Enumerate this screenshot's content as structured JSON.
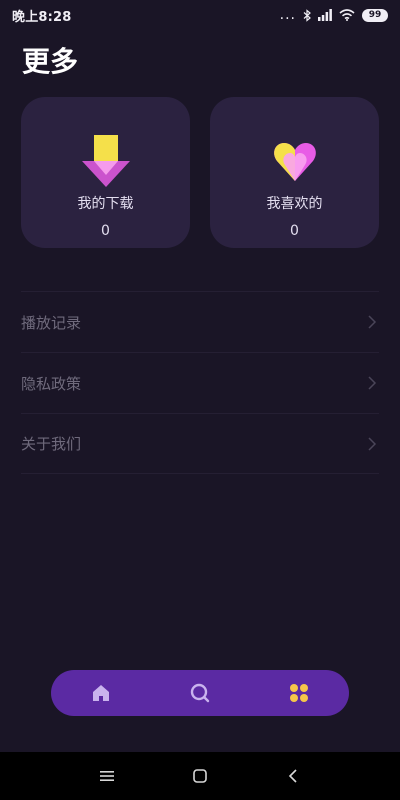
{
  "status_bar": {
    "time": "晚上8:28",
    "dots": "...",
    "battery": "99"
  },
  "page": {
    "title": "更多"
  },
  "cards": [
    {
      "label": "我的下载",
      "count": "0",
      "icon": "download-arrow-icon"
    },
    {
      "label": "我喜欢的",
      "count": "0",
      "icon": "heart-icon"
    }
  ],
  "menu": [
    {
      "label": "播放记录"
    },
    {
      "label": "隐私政策"
    },
    {
      "label": "关于我们"
    }
  ],
  "bottom_nav": [
    {
      "icon": "home-icon"
    },
    {
      "icon": "search-icon"
    },
    {
      "icon": "grid-menu-icon",
      "active": true
    }
  ],
  "colors": {
    "background": "#1a1526",
    "card": "#2b2240",
    "nav_bar": "#5b2aa3",
    "accent_yellow": "#f5e04a",
    "accent_pink": "#e85ce6"
  }
}
